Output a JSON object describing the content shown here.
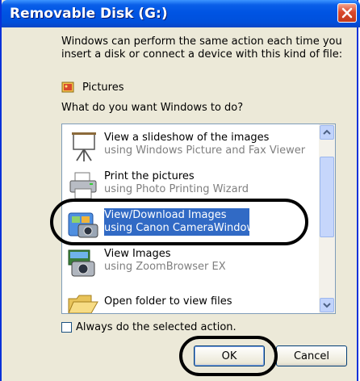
{
  "window": {
    "title": "Removable Disk (G:)"
  },
  "dialog": {
    "description": "Windows can perform the same action each time you insert a disk or connect a device with this kind of file:",
    "content_type": "Pictures",
    "question": "What do you want Windows to do?"
  },
  "actions": [
    {
      "title": "View a slideshow of the images",
      "subtitle": "using Windows Picture and Fax Viewer",
      "icon": "slideshow-projector-icon",
      "selected": false
    },
    {
      "title": "Print the pictures",
      "subtitle": "using Photo Printing Wizard",
      "icon": "printer-icon",
      "selected": false
    },
    {
      "title": "View/Download Images",
      "subtitle": "using Canon CameraWindow",
      "icon": "canon-camerawindow-icon",
      "selected": true
    },
    {
      "title": "View Images",
      "subtitle": "using ZoomBrowser EX",
      "icon": "zoombrowser-camera-icon",
      "selected": false
    },
    {
      "title": "Open folder to view files",
      "subtitle": "",
      "icon": "folder-icon",
      "selected": false
    }
  ],
  "checkbox": {
    "label": "Always do the selected action.",
    "checked": false
  },
  "buttons": {
    "ok": "OK",
    "cancel": "Cancel"
  },
  "colors": {
    "titlebar": "#0054e3",
    "selection": "#316ac5",
    "dialog_bg": "#ece9d8",
    "callout": "#000000"
  }
}
